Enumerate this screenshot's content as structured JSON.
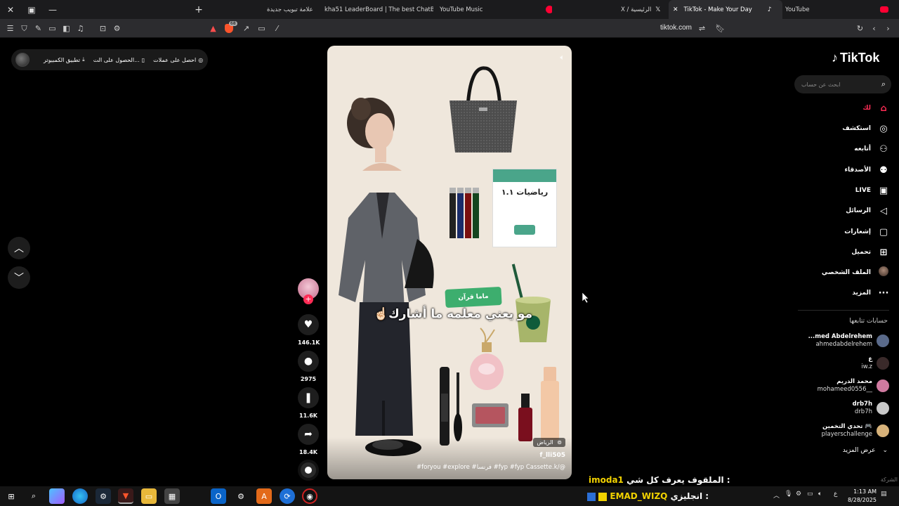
{
  "browser": {
    "tabs": [
      {
        "label": "علامة تبويب جديدة",
        "icon": "new-tab-icon",
        "color": "#444"
      },
      {
        "label": "kha51 LeaderBoard | The best ChatBo",
        "icon": "leaderboard-icon",
        "color": "#9a9a9a"
      },
      {
        "label": "YouTube Music",
        "icon": "youtube-music-icon",
        "color": "#ff0033"
      },
      {
        "label": "X / الرئيسية",
        "icon": "x-logo-icon",
        "color": "#ffffff"
      },
      {
        "label": "TikTok - Make Your Day",
        "icon": "tiktok-icon",
        "color": "#ffffff"
      },
      {
        "label": "YouTube",
        "icon": "youtube-icon",
        "color": "#ff0033"
      }
    ],
    "url": "tiktok.com",
    "shield_count": "68"
  },
  "topbar": {
    "get_coins": "احصل على عملات",
    "get_app": "الحصول على الت...",
    "desktop_app": "تطبيق الكمبيوتر"
  },
  "video": {
    "caption": "مو يعني معلمه ما أشارك☝🏻",
    "location": "الرياض",
    "username": "f_lli505",
    "tags": "#foryou #explore #فرنسا #fyp #fyp Cassette.k/@",
    "book_title": "رياضيات ١.١",
    "sticker_text": "ماما قرآن"
  },
  "actions": {
    "likes": "146.1K",
    "comments": "2975",
    "saves": "11.6K",
    "shares": "18.4K"
  },
  "sidebar": {
    "logo": "TikTok",
    "search_placeholder": "ابحث عن حساب",
    "nav": [
      {
        "label": "لك",
        "icon": "home-icon"
      },
      {
        "label": "استكشف",
        "icon": "compass-icon"
      },
      {
        "label": "أتابعه",
        "icon": "following-icon"
      },
      {
        "label": "الأصدقاء",
        "icon": "friends-icon"
      },
      {
        "label": "LIVE",
        "icon": "live-icon"
      },
      {
        "label": "الرسائل",
        "icon": "send-icon"
      },
      {
        "label": "إشعارات",
        "icon": "inbox-icon"
      },
      {
        "label": "تحميل",
        "icon": "upload-icon"
      },
      {
        "label": "الملف الشخصي",
        "icon": "profile-avatar-icon"
      },
      {
        "label": "المزيد",
        "icon": "more-dots-icon"
      }
    ],
    "following_header": "حسابات تتابعها",
    "accounts": [
      {
        "name": "...med Abdelrehem",
        "handle": "ahmedabdelrehem",
        "color": "#5a6a8a"
      },
      {
        "name": "ع",
        "handle": "iw.z",
        "color": "#3a2a2a"
      },
      {
        "name": "محمد الدريم",
        "handle": "mohameed0556__",
        "color": "#d07aa0"
      },
      {
        "name": "drb7h",
        "handle": "drb7h",
        "color": "#c8c8c8"
      },
      {
        "name": "تحدي التخمين 🎮",
        "handle": "playerschallenge",
        "color": "#d7b27a"
      }
    ],
    "see_more": "عرض المزيد",
    "company": "الشركة"
  },
  "stream_overlay": {
    "line1_text": "الملقوف يعرف كل شي :",
    "line1_user": "imoda1",
    "line2_text": "انجليزي :",
    "line2_user": "EMAD_WIZQ"
  },
  "taskbar": {
    "time": "1:13 AM",
    "date": "8/28/2025",
    "lang": "ع"
  },
  "colors": {
    "accent": "#fe2c55",
    "overlay_yellow": "#f2d200",
    "video_bg": "#efe7dc"
  }
}
